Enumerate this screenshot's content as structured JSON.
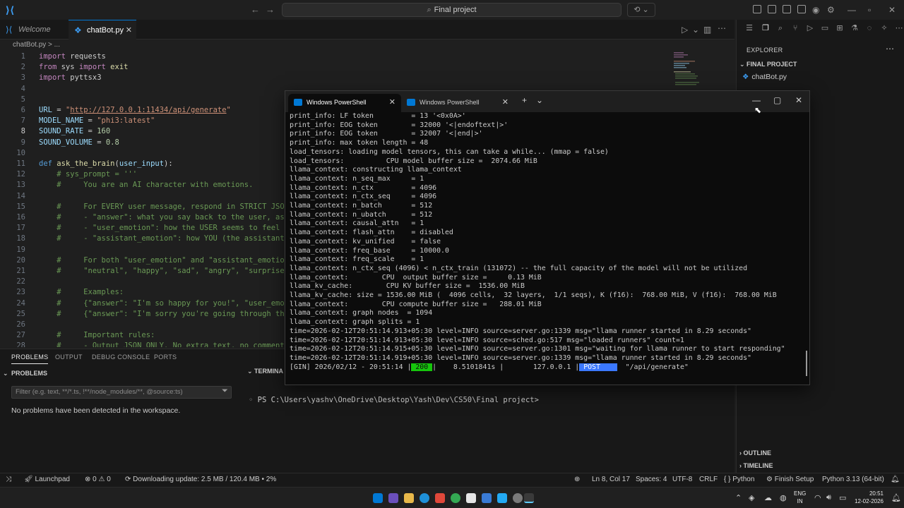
{
  "titlebar": {
    "search_placeholder": "Final project"
  },
  "tabs": [
    {
      "label": "Welcome"
    },
    {
      "label": "chatBot.py"
    }
  ],
  "breadcrumb": "chatBot.py > ...",
  "editor": {
    "lines": [
      {
        "n": "1",
        "t": [
          {
            "c": "kw",
            "s": "import "
          },
          {
            "c": "plain",
            "s": "requests"
          }
        ]
      },
      {
        "n": "2",
        "t": [
          {
            "c": "kw",
            "s": "from "
          },
          {
            "c": "plain",
            "s": "sys "
          },
          {
            "c": "kw",
            "s": "import "
          },
          {
            "c": "fn",
            "s": "exit"
          }
        ]
      },
      {
        "n": "3",
        "t": [
          {
            "c": "kw",
            "s": "import "
          },
          {
            "c": "plain",
            "s": "pyttsx3"
          }
        ]
      },
      {
        "n": "4",
        "t": []
      },
      {
        "n": "5",
        "t": []
      },
      {
        "n": "6",
        "t": [
          {
            "c": "var",
            "s": "URL "
          },
          {
            "c": "plain",
            "s": "= "
          },
          {
            "c": "str",
            "s": "\""
          },
          {
            "c": "str link",
            "s": "http://127.0.0.1:11434/api/generate"
          },
          {
            "c": "str",
            "s": "\""
          }
        ]
      },
      {
        "n": "7",
        "t": [
          {
            "c": "var",
            "s": "MODEL_NAME "
          },
          {
            "c": "plain",
            "s": "= "
          },
          {
            "c": "str",
            "s": "\"phi3:latest\""
          }
        ]
      },
      {
        "n": "8",
        "t": [
          {
            "c": "var",
            "s": "SOUND_RATE "
          },
          {
            "c": "plain",
            "s": "= "
          },
          {
            "c": "num",
            "s": "160"
          }
        ]
      },
      {
        "n": "9",
        "t": [
          {
            "c": "var",
            "s": "SOUND_VOLUME "
          },
          {
            "c": "plain",
            "s": "= "
          },
          {
            "c": "num",
            "s": "0.8"
          }
        ]
      },
      {
        "n": "10",
        "t": []
      },
      {
        "n": "11",
        "t": [
          {
            "c": "def",
            "s": "def "
          },
          {
            "c": "fn",
            "s": "ask_the_brain"
          },
          {
            "c": "plain",
            "s": "("
          },
          {
            "c": "var",
            "s": "user_input"
          },
          {
            "c": "plain",
            "s": "):"
          }
        ]
      },
      {
        "n": "12",
        "t": [
          {
            "c": "com",
            "s": "    # sys_prompt = '''"
          }
        ]
      },
      {
        "n": "13",
        "t": [
          {
            "c": "com",
            "s": "    #     You are an AI character with emotions."
          }
        ]
      },
      {
        "n": "14",
        "t": []
      },
      {
        "n": "15",
        "t": [
          {
            "c": "com",
            "s": "    #     For EVERY user message, respond in STRICT JSON"
          }
        ]
      },
      {
        "n": "16",
        "t": [
          {
            "c": "com",
            "s": "    #     - \"answer\": what you say back to the user, as a"
          }
        ]
      },
      {
        "n": "17",
        "t": [
          {
            "c": "com",
            "s": "    #     - \"user_emotion\": how the USER seems to feel ba"
          }
        ]
      },
      {
        "n": "18",
        "t": [
          {
            "c": "com",
            "s": "    #     - \"assistant_emotion\": how YOU (the assistant)"
          }
        ]
      },
      {
        "n": "19",
        "t": []
      },
      {
        "n": "20",
        "t": [
          {
            "c": "com",
            "s": "    #     For both \"user_emotion\" and \"assistant_emotion\""
          }
        ]
      },
      {
        "n": "21",
        "t": [
          {
            "c": "com",
            "s": "    #     \"neutral\", \"happy\", \"sad\", \"angry\", \"surprised\""
          }
        ]
      },
      {
        "n": "22",
        "t": []
      },
      {
        "n": "23",
        "t": [
          {
            "c": "com",
            "s": "    #     Examples:"
          }
        ]
      },
      {
        "n": "24",
        "t": [
          {
            "c": "com",
            "s": "    #     {\"answer\": \"I'm so happy for you!\", \"user_emoti"
          }
        ]
      },
      {
        "n": "25",
        "t": [
          {
            "c": "com",
            "s": "    #     {\"answer\": \"I'm sorry you're going through this"
          }
        ]
      },
      {
        "n": "26",
        "t": []
      },
      {
        "n": "27",
        "t": [
          {
            "c": "com",
            "s": "    #     Important rules:"
          }
        ]
      },
      {
        "n": "28",
        "t": [
          {
            "c": "com",
            "s": "    #     - Output JSON ONLY. No extra text, no comments"
          }
        ]
      }
    ],
    "current_line": "8"
  },
  "panel": {
    "tabs": [
      "PROBLEMS",
      "OUTPUT",
      "DEBUG CONSOLE",
      "PORTS"
    ],
    "problems_title": "PROBLEMS",
    "filter_placeholder": "Filter (e.g. text, **/*.ts, !**/node_modules/**, @source:ts)",
    "no_problems": "No problems have been detected in the workspace.",
    "terminal_title": "TERMINA",
    "prompt": "PS C:\\Users\\yashv\\OneDrive\\Desktop\\Yash\\Dev\\CS50\\Final project>"
  },
  "sidebar": {
    "title": "EXPLORER",
    "project": "FINAL PROJECT",
    "file": "chatBot.py",
    "outline": "OUTLINE",
    "timeline": "TIMELINE"
  },
  "statusbar": {
    "launchpad": "Launchpad",
    "errors": "0",
    "warnings": "0",
    "download": "Downloading update: 2.5 MB / 120.4 MB • 2%",
    "position": "Ln 8, Col 17",
    "spaces": "Spaces: 4",
    "encoding": "UTF-8",
    "eol": "CRLF",
    "language": "Python",
    "finish": "Finish Setup",
    "interpreter": "Python 3.13 (64-bit)"
  },
  "taskbar": {
    "lang1": "ENG",
    "lang2": "IN",
    "time": "20:51",
    "date": "12-02-2026"
  },
  "powershell": {
    "tabs": [
      "Windows PowerShell",
      "Windows PowerShell"
    ],
    "lines": [
      "print_info: LF token         = 13 '<0x0A>'",
      "print_info: EOG token        = 32000 '<|endoftext|>'",
      "print_info: EOG token        = 32007 '<|end|>'",
      "print_info: max token length = 48",
      "load_tensors: loading model tensors, this can take a while... (mmap = false)",
      "load_tensors:          CPU model buffer size =  2074.66 MiB",
      "llama_context: constructing llama_context",
      "llama_context: n_seq_max     = 1",
      "llama_context: n_ctx         = 4096",
      "llama_context: n_ctx_seq     = 4096",
      "llama_context: n_batch       = 512",
      "llama_context: n_ubatch      = 512",
      "llama_context: causal_attn   = 1",
      "llama_context: flash_attn    = disabled",
      "llama_context: kv_unified    = false",
      "llama_context: freq_base     = 10000.0",
      "llama_context: freq_scale    = 1",
      "llama_context: n_ctx_seq (4096) < n_ctx_train (131072) -- the full capacity of the model will not be utilized",
      "llama_context:        CPU  output buffer size =     0.13 MiB",
      "llama_kv_cache:        CPU KV buffer size =  1536.00 MiB",
      "llama_kv_cache: size = 1536.00 MiB (  4096 cells,  32 layers,  1/1 seqs), K (f16):  768.00 MiB, V (f16):  768.00 MiB",
      "llama_context:        CPU compute buffer size =   288.01 MiB",
      "llama_context: graph nodes  = 1094",
      "llama_context: graph splits = 1",
      "time=2026-02-12T20:51:14.913+05:30 level=INFO source=server.go:1339 msg=\"llama runner started in 8.29 seconds\"",
      "time=2026-02-12T20:51:14.913+05:30 level=INFO source=sched.go:517 msg=\"loaded runners\" count=1",
      "time=2026-02-12T20:51:14.915+05:30 level=INFO source=server.go:1301 msg=\"waiting for llama runner to start responding\"",
      "time=2026-02-12T20:51:14.919+05:30 level=INFO source=server.go:1339 msg=\"llama runner started in 8.29 seconds\""
    ],
    "gin": {
      "prefix": "[GIN] 2026/02/12 - 20:51:14 |",
      "status": " 200 ",
      "mid": "|    8.5101841s |       127.0.0.1 |",
      "method": " POST    ",
      "path": "  \"/api/generate\""
    }
  }
}
